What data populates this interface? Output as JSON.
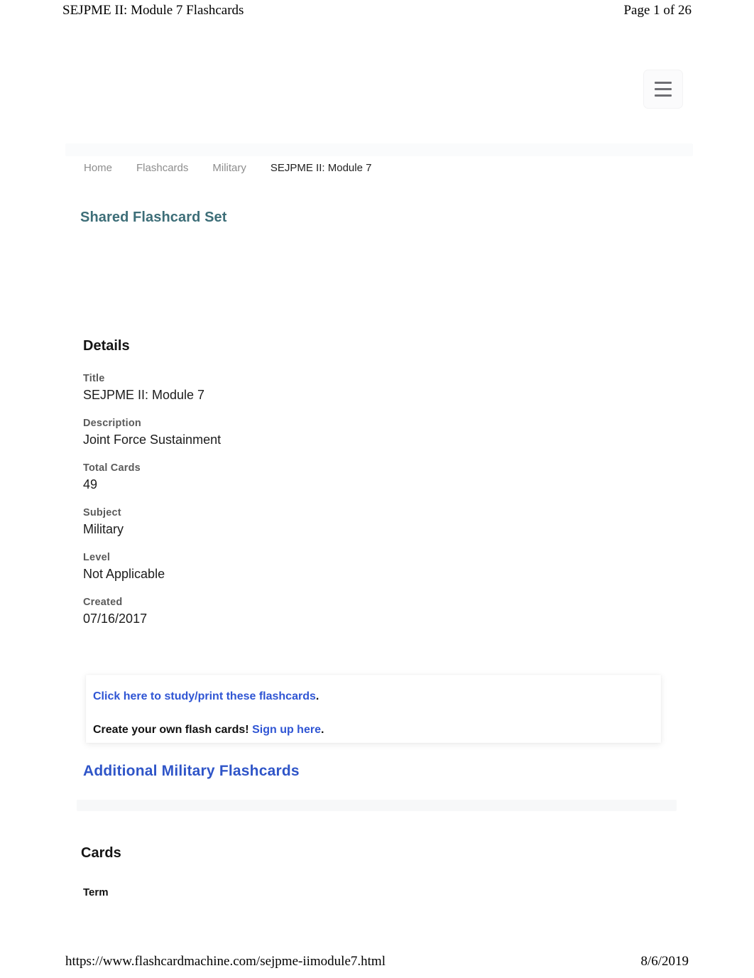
{
  "print": {
    "header_title": "SEJPME II: Module 7 Flashcards",
    "page_indicator": "Page 1 of 26",
    "footer_url": "https://www.flashcardmachine.com/sejpme-iimodule7.html",
    "footer_date": "8/6/2019"
  },
  "navbar": {
    "menu_icon": "hamburger-menu-icon"
  },
  "breadcrumb": {
    "items": [
      {
        "label": "Home",
        "current": false
      },
      {
        "label": "Flashcards",
        "current": false
      },
      {
        "label": "Military",
        "current": false
      },
      {
        "label": "SEJPME II: Module 7",
        "current": true
      }
    ]
  },
  "page_subtitle": "Shared Flashcard Set",
  "details": {
    "heading": "Details",
    "rows": [
      {
        "label": "Title",
        "value": "SEJPME II: Module 7"
      },
      {
        "label": "Description",
        "value": "Joint Force Sustainment"
      },
      {
        "label": "Total Cards",
        "value": "49"
      },
      {
        "label": "Subject",
        "value": "Military"
      },
      {
        "label": "Level",
        "value": "Not Applicable"
      },
      {
        "label": "Created",
        "value": "07/16/2017"
      }
    ]
  },
  "cta": {
    "study_link": "Click here to study/print these flashcards",
    "study_tail": ".",
    "create_text": "Create your own flash cards!",
    "signup_link": "Sign up here",
    "signup_tail": "."
  },
  "additional_link": "Additional Military Flashcards",
  "cards": {
    "heading": "Cards",
    "term_header": "Term"
  },
  "colors": {
    "teal": "#3d6e78",
    "link_blue": "#2f55d4",
    "heading_blue": "#2f55c8",
    "muted_gray": "#8d8d8d",
    "label_gray": "#5b5b5b"
  }
}
